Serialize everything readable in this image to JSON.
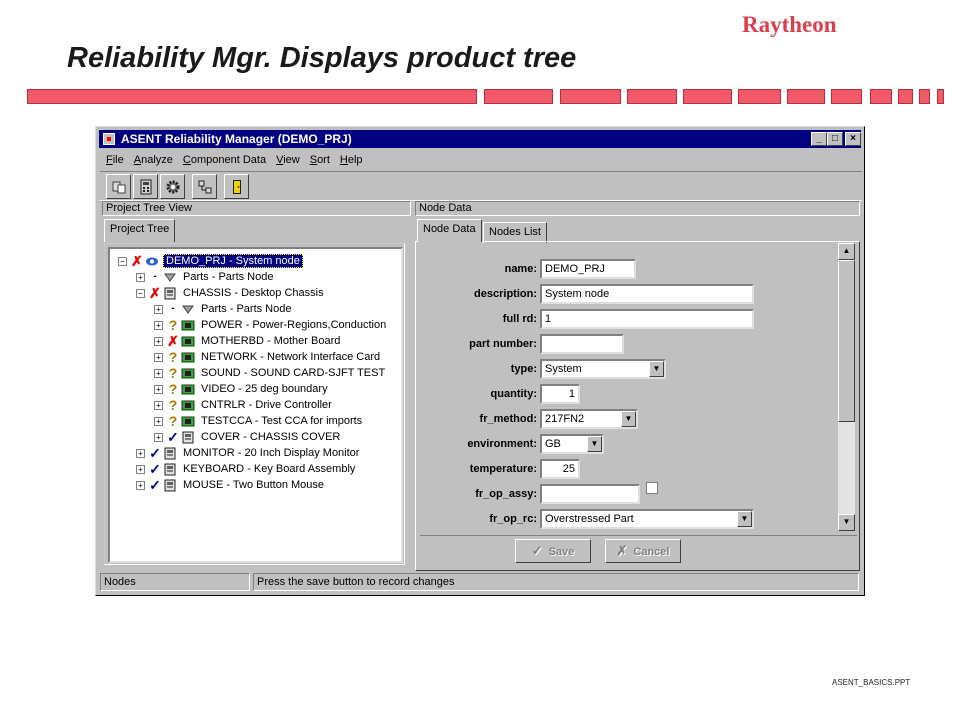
{
  "slide": {
    "title": "Reliability Mgr. Displays product tree",
    "brand": "Raytheon",
    "footer": "ASENT_BASICS.PPT"
  },
  "window": {
    "title": "ASENT Reliability Manager (DEMO_PRJ)",
    "controls": [
      "_",
      "□",
      "×"
    ]
  },
  "menu": [
    "File",
    "Analyze",
    "Component Data",
    "View",
    "Sort",
    "Help"
  ],
  "toolbar": [
    "parts-icon",
    "calculator-icon",
    "gear-icon",
    "tree-icon",
    "exit-door-icon"
  ],
  "left_pane": {
    "header": "Project Tree View",
    "tab": "Project Tree"
  },
  "right_pane": {
    "header": "Node Data",
    "tabs": [
      "Node Data",
      "Nodes List"
    ]
  },
  "tree": [
    {
      "label": "DEMO_PRJ  -  System node",
      "level": 0,
      "expander": "−",
      "status": "✗",
      "icon": "system-node-icon",
      "selected": true
    },
    {
      "label": "Parts  -  Parts Node",
      "level": 1,
      "expander": "+",
      "status": "-",
      "icon": "parts-node-icon"
    },
    {
      "label": "CHASSIS  -  Desktop Chassis",
      "level": 1,
      "expander": "−",
      "status": "✗",
      "icon": "component-icon"
    },
    {
      "label": "Parts  -  Parts Node",
      "level": 2,
      "expander": "+",
      "status": "-",
      "icon": "parts-node-icon"
    },
    {
      "label": "POWER  -  Power-Regions,Conduction",
      "level": 2,
      "expander": "+",
      "status": "?",
      "icon": "board-icon"
    },
    {
      "label": "MOTHERBD  -  Mother Board",
      "level": 2,
      "expander": "+",
      "status": "✗",
      "icon": "board-icon"
    },
    {
      "label": "NETWORK  -  Network Interface Card",
      "level": 2,
      "expander": "+",
      "status": "?",
      "icon": "board-icon"
    },
    {
      "label": "SOUND  -  SOUND CARD-SJFT TEST",
      "level": 2,
      "expander": "+",
      "status": "?",
      "icon": "board-icon"
    },
    {
      "label": "VIDEO  -  25 deg boundary",
      "level": 2,
      "expander": "+",
      "status": "?",
      "icon": "board-icon"
    },
    {
      "label": "CNTRLR  -  Drive Controller",
      "level": 2,
      "expander": "+",
      "status": "?",
      "icon": "board-icon"
    },
    {
      "label": "TESTCCA  -  Test CCA for imports",
      "level": 2,
      "expander": "+",
      "status": "?",
      "icon": "board-icon"
    },
    {
      "label": "COVER  -  CHASSIS COVER",
      "level": 2,
      "expander": "+",
      "status": "✓",
      "icon": "component-icon"
    },
    {
      "label": "MONITOR  -  20 Inch Display Monitor",
      "level": 1,
      "expander": "+",
      "status": "✓",
      "icon": "component-icon"
    },
    {
      "label": "KEYBOARD  -  Key Board Assembly",
      "level": 1,
      "expander": "+",
      "status": "✓",
      "icon": "component-icon"
    },
    {
      "label": "MOUSE  -  Two Button Mouse",
      "level": 1,
      "expander": "+",
      "status": "✓",
      "icon": "component-icon"
    }
  ],
  "form": [
    {
      "label": "name:",
      "value": "DEMO_PRJ",
      "type": "text",
      "w": 96
    },
    {
      "label": "description:",
      "value": "System node",
      "type": "text",
      "w": 214
    },
    {
      "label": "full rd:",
      "value": "1",
      "type": "text",
      "w": 214
    },
    {
      "label": "part number:",
      "value": "",
      "type": "text",
      "w": 84
    },
    {
      "label": "type:",
      "value": "System",
      "type": "select",
      "w": 126
    },
    {
      "label": "quantity:",
      "value": "1",
      "type": "number",
      "w": 40
    },
    {
      "label": "fr_method:",
      "value": "217FN2",
      "type": "select",
      "w": 98
    },
    {
      "label": "environment:",
      "value": "GB",
      "type": "select",
      "w": 64
    },
    {
      "label": "temperature:",
      "value": "25",
      "type": "number",
      "w": 40
    },
    {
      "label": "fr_op_assy:",
      "value": "",
      "type": "text-check",
      "w": 100
    },
    {
      "label": "fr_op_rc:",
      "value": "Overstressed Part",
      "type": "select",
      "w": 214
    }
  ],
  "actions": {
    "save": "Save",
    "cancel": "Cancel"
  },
  "status": {
    "left": "Nodes",
    "message": "Press the save button to record changes"
  }
}
